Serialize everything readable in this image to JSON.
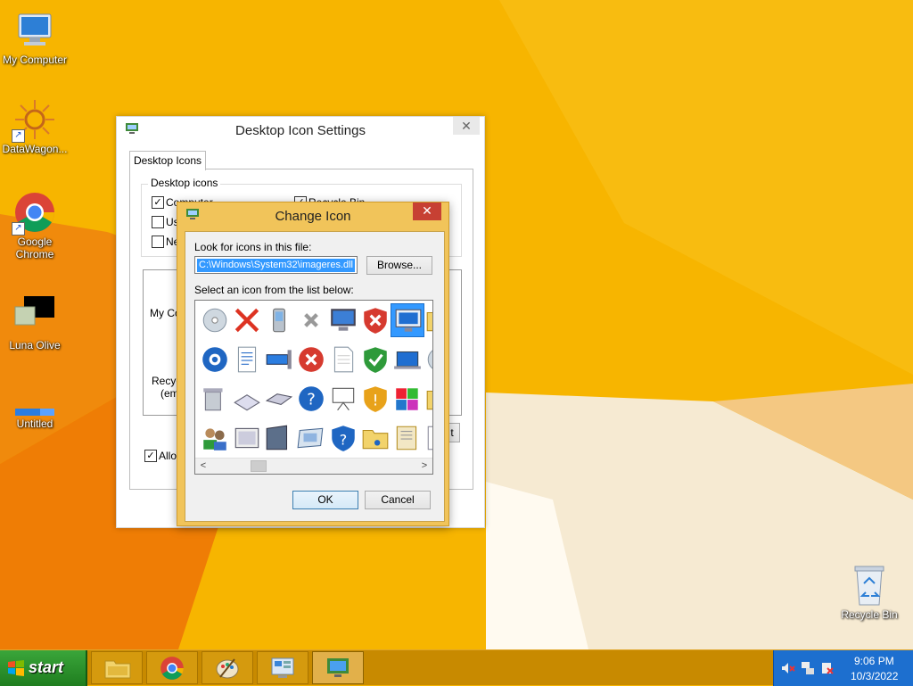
{
  "desktop": {
    "icons": [
      {
        "label": "My Computer"
      },
      {
        "label": "DataWagon..."
      },
      {
        "label": "Google Chrome"
      },
      {
        "label": "Luna Olive"
      },
      {
        "label": "Untitled"
      },
      {
        "label": "Recycle Bin"
      }
    ]
  },
  "desktop_icon_settings": {
    "title": "Desktop Icon Settings",
    "close_glyph": "✕",
    "tab_label": "Desktop Icons",
    "group_label": "Desktop icons",
    "checkboxes": [
      {
        "label": "Computer",
        "checked": true
      },
      {
        "label": "Recycle Bin",
        "checked": true
      },
      {
        "label": "Use",
        "checked": false
      },
      {
        "label": "Ne",
        "checked": false
      }
    ],
    "preview": [
      {
        "label": "My Con"
      },
      {
        "label": "Recyc"
      },
      {
        "label": "(em"
      }
    ],
    "change_icon_fragment": "t",
    "allow_label": "Allow",
    "allow_checked": true,
    "check_glyph": "✓"
  },
  "change_icon": {
    "title": "Change Icon",
    "close_glyph": "✕",
    "file_label": "Look for icons in this file:",
    "file_value": "C:\\Windows\\System32\\imageres.dll",
    "browse_label": "Browse...",
    "list_label": "Select an icon from the list below:",
    "ok_label": "OK",
    "cancel_label": "Cancel",
    "scroll_left": "<",
    "scroll_right": ">",
    "icons": [
      "disc-drive-icon",
      "red-x-icon",
      "pda-icon",
      "gray-x-icon",
      "monitor-icon",
      "shield-red-x-icon",
      "monitor-selected-icon",
      "folder-icon",
      "blue-compass-icon",
      "document-lines-icon",
      "network-adapter-icon",
      "error-x-icon",
      "blank-document-icon",
      "shield-check-icon",
      "laptop-icon",
      "globe-icon",
      "trash-box-icon",
      "scanner-icon",
      "flat-drive-icon",
      "help-icon",
      "projector-icon",
      "shield-warning-icon",
      "windows-colors-icon",
      "folder-icon-2",
      "users-icon",
      "frame-icon",
      "folder-gray-icon",
      "screen-window-icon",
      "shield-help-icon",
      "music-folder-icon",
      "docs-folder-icon",
      "green-arrows-icon"
    ],
    "selected_index": 6
  },
  "taskbar": {
    "start_label": "start",
    "clock_time": "9:06 PM",
    "clock_date": "10/3/2022"
  }
}
